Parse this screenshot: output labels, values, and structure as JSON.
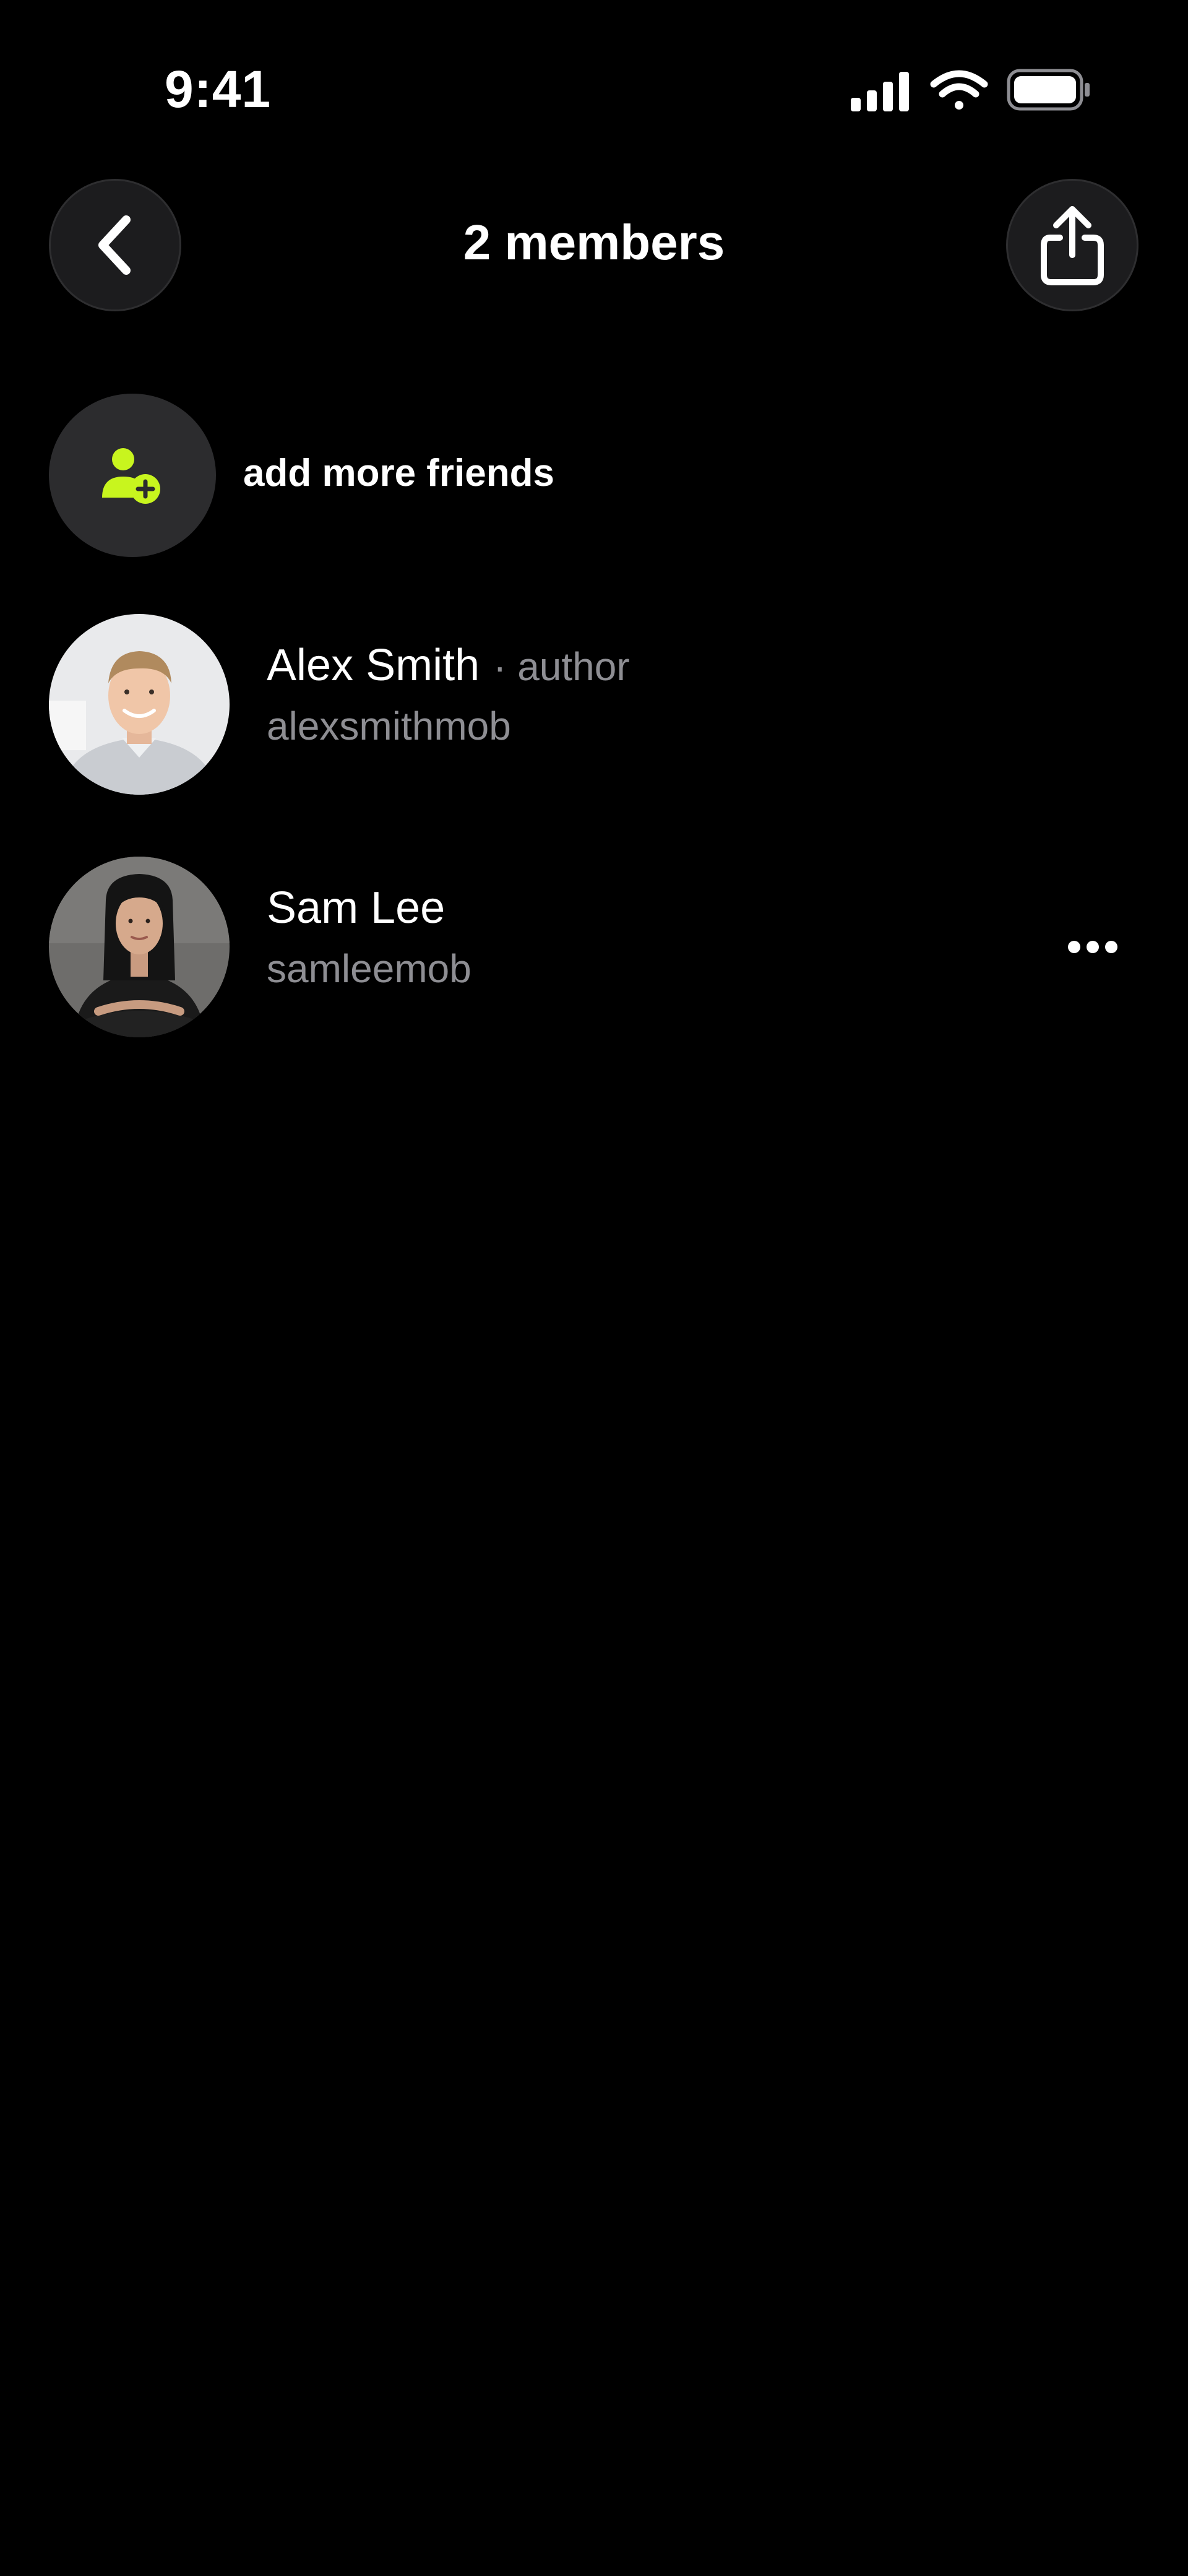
{
  "status_bar": {
    "time": "9:41"
  },
  "header": {
    "title": "2 members"
  },
  "add_friends": {
    "label": "add more friends",
    "accent_color": "#c8f51e"
  },
  "members": [
    {
      "name": "Alex Smith",
      "role": "· author",
      "handle": "alexsmithmob"
    },
    {
      "name": "Sam Lee",
      "handle": "samleemob"
    }
  ],
  "icons": {
    "back": "chevron-left-icon",
    "share": "share-icon",
    "add_friend": "add-user-icon",
    "more": "more-horizontal-icon"
  }
}
